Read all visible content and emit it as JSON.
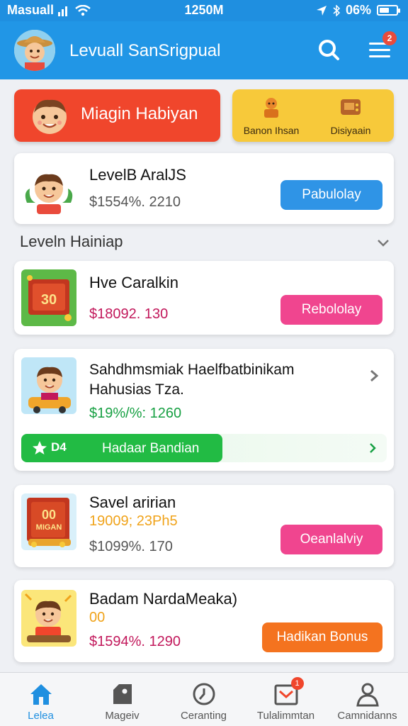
{
  "status_bar": {
    "carrier": "Masuall",
    "time": "1250M",
    "battery": "06%",
    "battery_level": 0.6
  },
  "header": {
    "title": "Levuall SanSrigpual",
    "menu_badge": "2"
  },
  "hero": {
    "primary_label": "Miagin Habiyan",
    "secondary_items": [
      {
        "label": "Banon Ihsan"
      },
      {
        "label": "Disiyaain"
      }
    ]
  },
  "featured": {
    "name": "LevelB AralJS",
    "price": "$1554%. 2210",
    "button": "Pabulolay"
  },
  "section": {
    "title": "Leveln Hainiap"
  },
  "items": [
    {
      "name": "Hve Caralkin",
      "thumb_text": "30",
      "price": "$18092. 130",
      "price_color": "#c2185b",
      "button": "Rebololay",
      "button_color": "#f0458f"
    },
    {
      "name_line1": "Sahdhmsmiak Haelfbatbinikam",
      "name_line2": "Hahusias Tza.",
      "price": "$19%/%: 1260",
      "price_color": "#17a043",
      "promo_label": "Hadaar Bandian",
      "promo_extra": "D4",
      "promo_level": 0.55
    },
    {
      "name": "Savel aririan",
      "sub_price": "19009; 23Ph5",
      "thumb_text_1": "00",
      "thumb_text_2": "MIGAN",
      "price": "$1099%. 170",
      "price_color": "#555555",
      "button": "Oeanlalviy",
      "button_color": "#f0458f"
    },
    {
      "name": "Badam NardaMeaka)",
      "sub_price": "00",
      "price": "$1594%. 1290",
      "price_color": "#c2185b",
      "button": "Hadikan Bonus",
      "button_color": "#f4731f"
    }
  ],
  "tabs": [
    {
      "label": "Lelea",
      "icon": "home-icon",
      "active": true
    },
    {
      "label": "Mageiv",
      "icon": "tag-icon",
      "active": false
    },
    {
      "label": "Ceranting",
      "icon": "clock-icon",
      "active": false
    },
    {
      "label": "Tulalimmtan",
      "icon": "inbox-icon",
      "active": false,
      "badge": "1"
    },
    {
      "label": "Camnidanns",
      "icon": "person-icon",
      "active": false
    }
  ],
  "colors": {
    "primary": "#2196e6",
    "red": "#f0462c",
    "yellow": "#f7c93a",
    "blue_button": "#2f94e6",
    "pink_button": "#f0458f",
    "orange_button": "#f4731f",
    "green": "#22bb44"
  }
}
